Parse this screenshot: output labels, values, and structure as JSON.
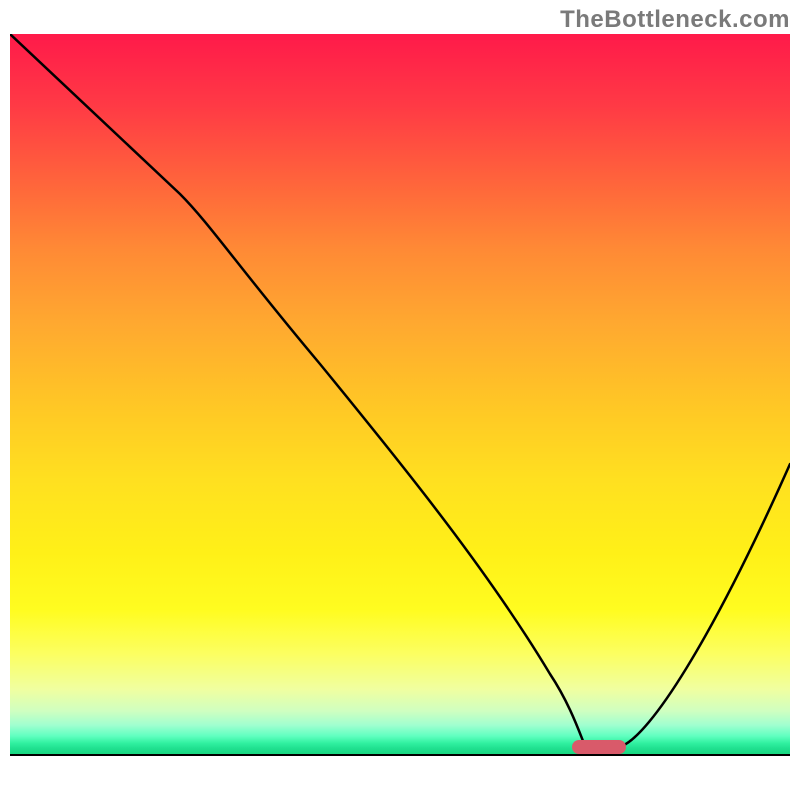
{
  "watermark": "TheBottleneck.com",
  "colors": {
    "curve": "#000000",
    "marker": "#d95a6a",
    "baseline": "#000000",
    "watermark_text": "#7a7a7a"
  },
  "chart_data": {
    "type": "line",
    "title": "",
    "xlabel": "",
    "ylabel": "",
    "xlim": [
      0,
      100
    ],
    "ylim": [
      0,
      100
    ],
    "grid": false,
    "legend": false,
    "series": [
      {
        "name": "bottleneck-curve",
        "x": [
          0,
          10,
          22,
          30,
          40,
          50,
          60,
          68,
          72,
          76,
          82,
          90,
          100
        ],
        "values": [
          100,
          90,
          78,
          68,
          55,
          41,
          28,
          14,
          4,
          1,
          3,
          16,
          40
        ]
      }
    ],
    "marker": {
      "x_start": 72,
      "x_end": 79,
      "y": 1,
      "color": "#d95a6a"
    },
    "gradient_stops": [
      {
        "pos": 0,
        "color": "#ff1a4a"
      },
      {
        "pos": 10,
        "color": "#ff3a45"
      },
      {
        "pos": 22,
        "color": "#ff6a3a"
      },
      {
        "pos": 30,
        "color": "#ff8a35"
      },
      {
        "pos": 40,
        "color": "#ffa830"
      },
      {
        "pos": 52,
        "color": "#ffc825"
      },
      {
        "pos": 62,
        "color": "#ffe020"
      },
      {
        "pos": 72,
        "color": "#fff018"
      },
      {
        "pos": 80,
        "color": "#fffc20"
      },
      {
        "pos": 86,
        "color": "#fcff60"
      },
      {
        "pos": 91,
        "color": "#f0ffa0"
      },
      {
        "pos": 94,
        "color": "#d0ffc0"
      },
      {
        "pos": 96,
        "color": "#a0ffd0"
      },
      {
        "pos": 97.5,
        "color": "#60ffc0"
      },
      {
        "pos": 98.5,
        "color": "#30f0a0"
      },
      {
        "pos": 99.2,
        "color": "#20e090"
      },
      {
        "pos": 100,
        "color": "#18d880"
      }
    ]
  }
}
